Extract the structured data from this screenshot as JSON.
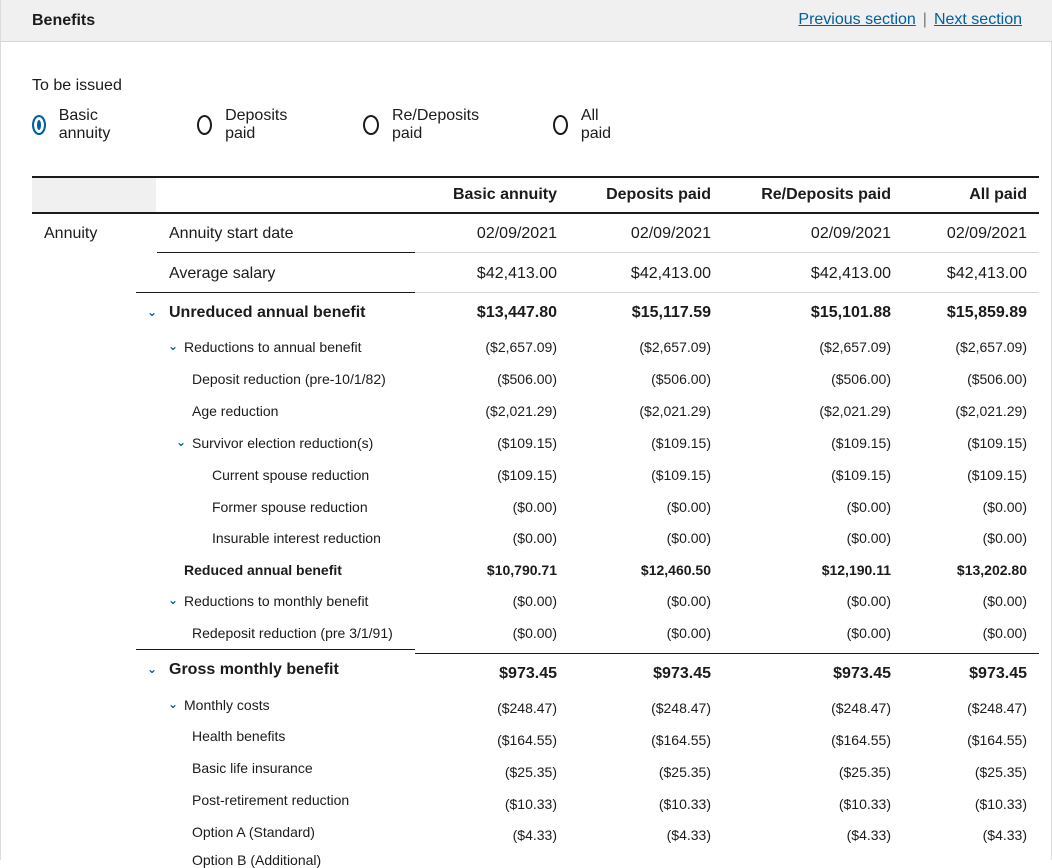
{
  "header": {
    "title": "Benefits",
    "prev_link": "Previous section",
    "separator": "|",
    "next_link": "Next section"
  },
  "issue": {
    "label": "To be issued",
    "options": [
      "Basic annuity",
      "Deposits paid",
      "Re/Deposits paid",
      "All paid"
    ],
    "selected": "Basic annuity"
  },
  "table": {
    "columns": [
      "Basic annuity",
      "Deposits paid",
      "Re/Deposits paid",
      "All paid"
    ],
    "category": "Annuity",
    "rows": [
      {
        "label": "Annuity start date",
        "values": [
          "02/09/2021",
          "02/09/2021",
          "02/09/2021",
          "02/09/2021"
        ]
      },
      {
        "label": "Average salary",
        "values": [
          "$42,413.00",
          "$42,413.00",
          "$42,413.00",
          "$42,413.00"
        ]
      },
      {
        "label": "Unreduced annual benefit",
        "values": [
          "$13,447.80",
          "$15,117.59",
          "$15,101.88",
          "$15,859.89"
        ]
      },
      {
        "label": "Reductions to annual benefit",
        "values": [
          "($2,657.09)",
          "($2,657.09)",
          "($2,657.09)",
          "($2,657.09)"
        ]
      },
      {
        "label": "Deposit reduction (pre-10/1/82)",
        "values": [
          "($506.00)",
          "($506.00)",
          "($506.00)",
          "($506.00)"
        ]
      },
      {
        "label": "Age reduction",
        "values": [
          "($2,021.29)",
          "($2,021.29)",
          "($2,021.29)",
          "($2,021.29)"
        ]
      },
      {
        "label": "Survivor election reduction(s)",
        "values": [
          "($109.15)",
          "($109.15)",
          "($109.15)",
          "($109.15)"
        ]
      },
      {
        "label": "Current spouse reduction",
        "values": [
          "($109.15)",
          "($109.15)",
          "($109.15)",
          "($109.15)"
        ]
      },
      {
        "label": "Former spouse reduction",
        "values": [
          "($0.00)",
          "($0.00)",
          "($0.00)",
          "($0.00)"
        ]
      },
      {
        "label": "Insurable interest reduction",
        "values": [
          "($0.00)",
          "($0.00)",
          "($0.00)",
          "($0.00)"
        ]
      },
      {
        "label": "Reduced annual benefit",
        "values": [
          "$10,790.71",
          "$12,460.50",
          "$12,190.11",
          "$13,202.80"
        ]
      },
      {
        "label": "Reductions to monthly benefit",
        "values": [
          "($0.00)",
          "($0.00)",
          "($0.00)",
          "($0.00)"
        ]
      },
      {
        "label": "Redeposit reduction (pre 3/1/91)",
        "values": [
          "($0.00)",
          "($0.00)",
          "($0.00)",
          "($0.00)"
        ]
      },
      {
        "label": "Gross monthly benefit",
        "values": [
          "$973.45",
          "$973.45",
          "$973.45",
          "$973.45"
        ]
      },
      {
        "label": "Monthly costs",
        "values": [
          "($248.47)",
          "($248.47)",
          "($248.47)",
          "($248.47)"
        ]
      },
      {
        "label": "Health benefits",
        "values": [
          "($164.55)",
          "($164.55)",
          "($164.55)",
          "($164.55)"
        ]
      },
      {
        "label": "Basic life insurance",
        "values": [
          "($25.35)",
          "($25.35)",
          "($25.35)",
          "($25.35)"
        ]
      },
      {
        "label": "Post-retirement reduction",
        "values": [
          "($10.33)",
          "($10.33)",
          "($10.33)",
          "($10.33)"
        ]
      },
      {
        "label": "Option A (Standard)",
        "values": [
          "($4.33)",
          "($4.33)",
          "($4.33)",
          "($4.33)"
        ]
      },
      {
        "label": "Option B (Additional)",
        "values": [
          "",
          "",
          "",
          ""
        ]
      }
    ]
  },
  "icons": {
    "chevron": "chevron-down-icon"
  },
  "colors": {
    "link": "#005ea2",
    "accent": "#005ea2",
    "header_bg": "#f0f0f0"
  }
}
